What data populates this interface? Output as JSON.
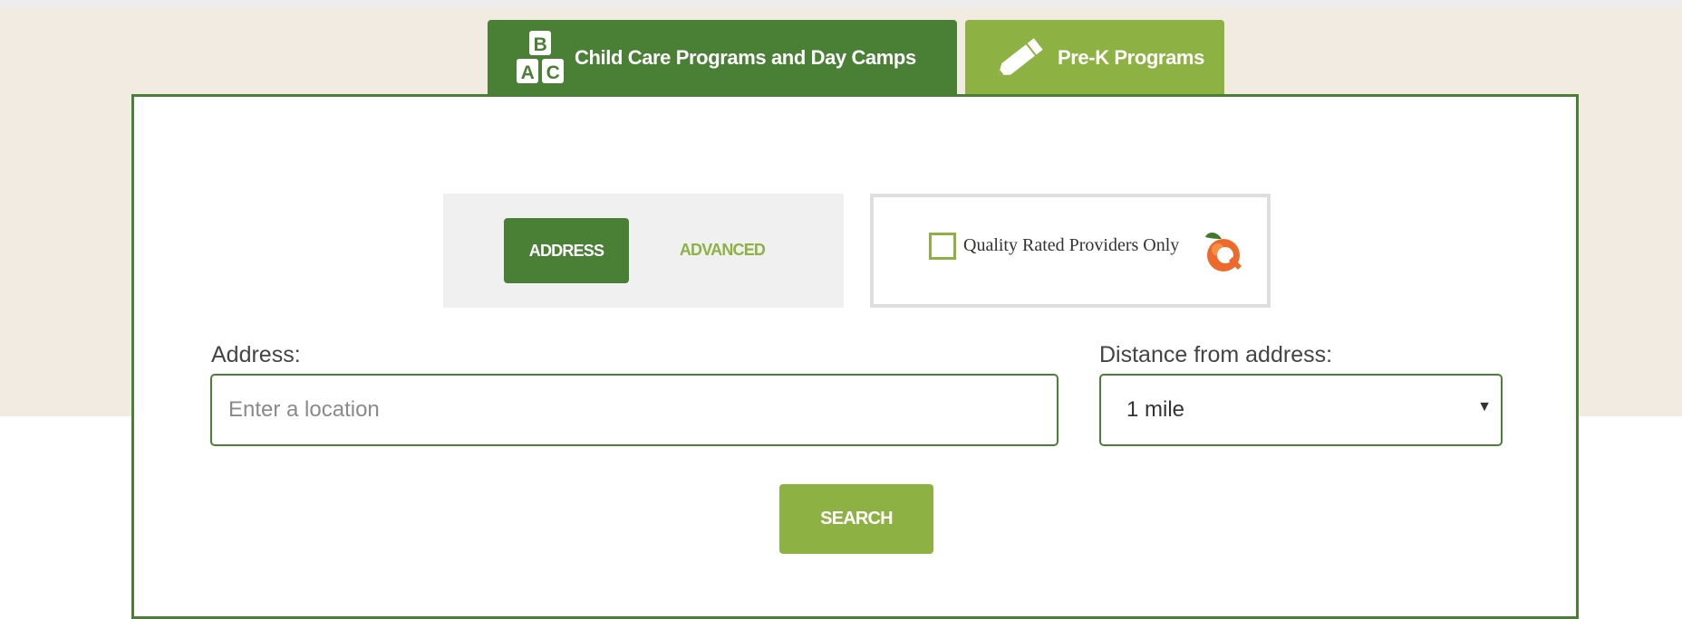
{
  "tabs": {
    "child_care": {
      "label": "Child Care Programs and Day Camps",
      "icon": "abc-blocks-icon"
    },
    "pre_k": {
      "label": "Pre-K Programs",
      "icon": "pencil-icon"
    }
  },
  "search_mode": {
    "address_label": "ADDRESS",
    "advanced_label": "ADVANCED",
    "selected": "ADDRESS"
  },
  "quality_filter": {
    "label": "Quality Rated Providers Only",
    "checked": false,
    "logo": "quality-rated-peach-logo"
  },
  "address": {
    "label": "Address:",
    "placeholder": "Enter a location",
    "value": ""
  },
  "distance": {
    "label": "Distance from address:",
    "selected": "1 mile"
  },
  "search_button": {
    "label": "SEARCH"
  },
  "colors": {
    "dark_green": "#4a7f36",
    "light_green": "#8db142",
    "beige": "#f2ebe1",
    "peach_orange": "#ee6a2c"
  }
}
